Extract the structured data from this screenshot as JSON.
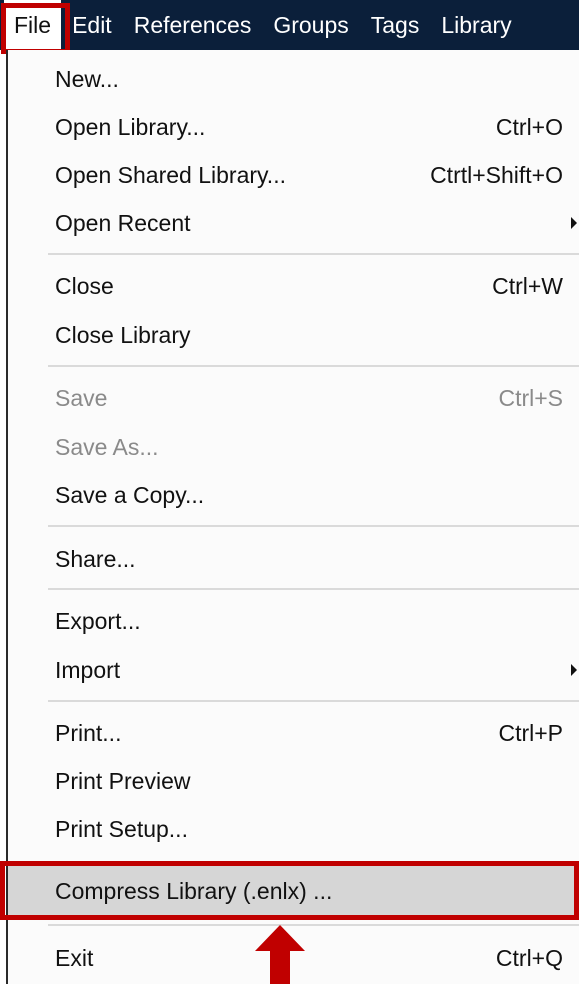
{
  "menubar": {
    "items": [
      "File",
      "Edit",
      "References",
      "Groups",
      "Tags",
      "Library"
    ]
  },
  "file_menu": {
    "items": [
      {
        "label": "New...",
        "shortcut": ""
      },
      {
        "label": "Open Library...",
        "shortcut": "Ctrl+O"
      },
      {
        "label": "Open Shared Library...",
        "shortcut": "Ctrtl+Shift+O"
      },
      {
        "label": "Open Recent",
        "shortcut": "",
        "submenu": true
      },
      {
        "label": "Close",
        "shortcut": "Ctrl+W"
      },
      {
        "label": "Close Library",
        "shortcut": ""
      },
      {
        "label": "Save",
        "shortcut": "Ctrl+S",
        "disabled": true
      },
      {
        "label": "Save As...",
        "shortcut": "",
        "disabled": true
      },
      {
        "label": "Save a Copy...",
        "shortcut": ""
      },
      {
        "label": "Share...",
        "shortcut": ""
      },
      {
        "label": "Export...",
        "shortcut": ""
      },
      {
        "label": "Import",
        "shortcut": "",
        "submenu": true
      },
      {
        "label": "Print...",
        "shortcut": "Ctrl+P"
      },
      {
        "label": "Print Preview",
        "shortcut": ""
      },
      {
        "label": "Print Setup...",
        "shortcut": ""
      },
      {
        "label": "Compress Library (.enlx) ...",
        "shortcut": "",
        "highlighted": true
      },
      {
        "label": "Exit",
        "shortcut": "Ctrl+Q"
      }
    ]
  },
  "annotation": {
    "highlight_color": "#c00000",
    "arrow_icon": "arrow-up-icon"
  }
}
